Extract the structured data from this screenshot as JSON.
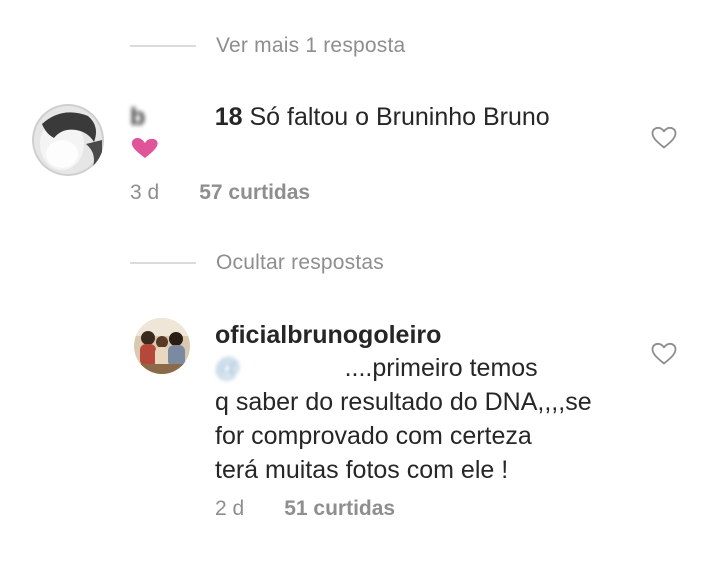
{
  "thread": {
    "view_more_label": "Ver mais 1 resposta",
    "hide_replies_label": "Ocultar respostas"
  },
  "comments": [
    {
      "username_visible_suffix": "18",
      "username_obscured": "b          ",
      "text": " Só faltou o Bruninho Bruno",
      "emoji": "heart-emoji",
      "time": "3 d",
      "likes": "57 curtidas"
    },
    {
      "username": "oficialbrunogoleiro",
      "mention_obscured": "@              ",
      "text_line1": " ....primeiro temos",
      "text_line2": "q saber do resultado do DNA,,,,se",
      "text_line3": "for comprovado com certeza",
      "text_line4": "terá muitas fotos com ele !",
      "time": "2 d",
      "likes": "51 curtidas"
    }
  ],
  "colors": {
    "text": "#262626",
    "secondary": "#8e8e8e",
    "divider": "#dbdbdb",
    "emoji_heart": "#e0559a"
  }
}
